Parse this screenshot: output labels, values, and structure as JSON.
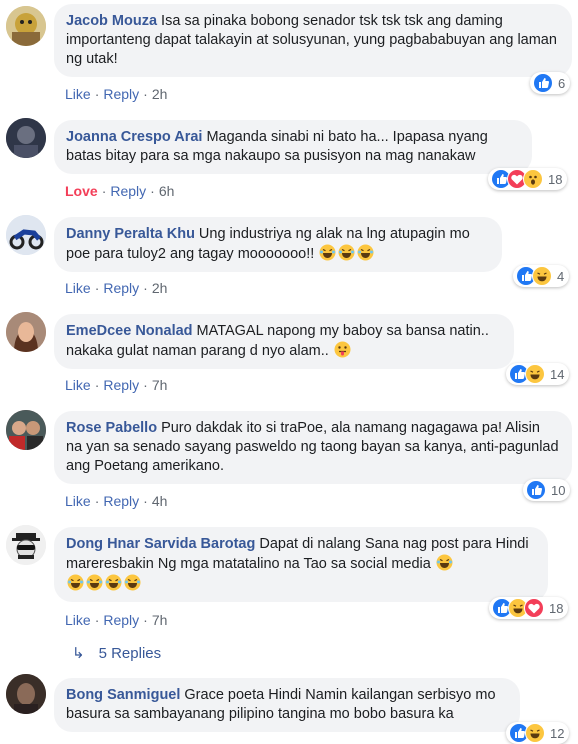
{
  "comments": [
    {
      "author": "Jacob Mouza",
      "text": "Isa sa pinaka bobong senador tsk tsk tsk ang daming importanteng dapat talakayin at solusyunan, yung pagbababuyan ang laman ng utak!",
      "reaction_label": "Like",
      "reply_label": "Reply",
      "time": "2h",
      "reaction_count": "6",
      "reactions": [
        "like-icon"
      ]
    },
    {
      "author": "Joanna Crespo Arai",
      "text": "Maganda sinabi ni bato ha... Ipapasa nyang batas bitay para sa mga nakaupo sa pusisyon na mag nanakaw",
      "reaction_label": "Love",
      "reply_label": "Reply",
      "time": "6h",
      "reaction_count": "18",
      "reactions": [
        "like-icon",
        "love-icon",
        "wow-icon"
      ]
    },
    {
      "author": "Danny Peralta Khu",
      "text": "Ung industriya ng alak na lng atupagin mo poe para tuloy2 ang tagay mooooooo!!",
      "reaction_label": "Like",
      "reply_label": "Reply",
      "time": "2h",
      "reaction_count": "4",
      "reactions": [
        "like-icon",
        "haha-icon"
      ]
    },
    {
      "author": "EmeDcee Nonalad",
      "text": "MATAGAL napong my baboy sa bansa natin.. nakaka gulat naman parang d nyo alam..",
      "reaction_label": "Like",
      "reply_label": "Reply",
      "time": "7h",
      "reaction_count": "14",
      "reactions": [
        "like-icon",
        "haha-icon"
      ]
    },
    {
      "author": "Rose Pabello",
      "text": "Puro dakdak ito si traPoe, ala namang nagagawa pa! Alisin na yan sa senado sayang pasweldo ng taong bayan sa kanya, anti-pagunlad ang Poetang amerikano.",
      "reaction_label": "Like",
      "reply_label": "Reply",
      "time": "4h",
      "reaction_count": "10",
      "reactions": [
        "like-icon"
      ]
    },
    {
      "author": "Dong Hnar Sarvida Barotag",
      "text": "Dapat di nalang Sana nag post para Hindi mareresbakin Ng mga matatalino na Tao sa social media",
      "reaction_label": "Like",
      "reply_label": "Reply",
      "time": "7h",
      "reaction_count": "18",
      "reactions": [
        "like-icon",
        "haha-icon",
        "love-icon"
      ]
    },
    {
      "author": "Bong Sanmiguel",
      "text": "Grace poeta Hindi Namin kailangan serbisyo mo basura sa sambayanang pilipino tangina mo bobo basura ka",
      "reaction_label": "",
      "reply_label": "",
      "time": "",
      "reaction_count": "12",
      "reactions": [
        "like-icon",
        "haha-icon"
      ]
    }
  ],
  "replies": {
    "label": "5 Replies"
  },
  "colors": {
    "link": "#385898",
    "action": "#4267b2",
    "love": "#f33e58",
    "bubble": "#f2f3f5",
    "like": "#2078f4",
    "haha": "#fcc63f"
  }
}
